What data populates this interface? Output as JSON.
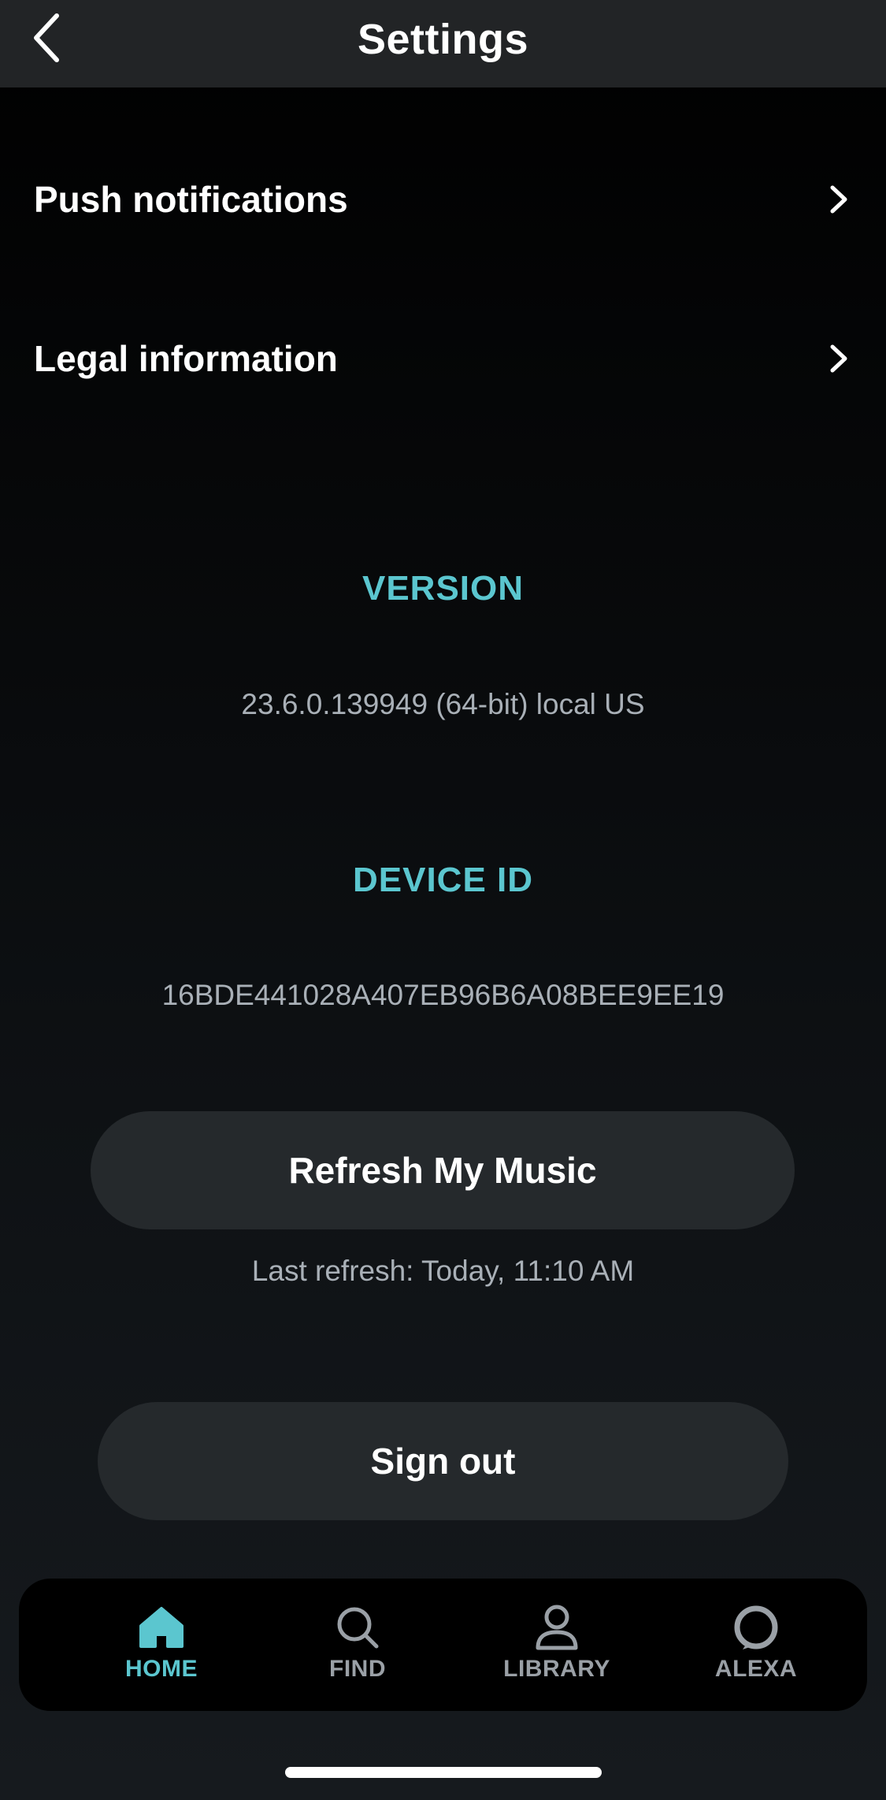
{
  "header": {
    "title": "Settings",
    "back_icon": "chevron-left-icon"
  },
  "menu": [
    {
      "label": "Push notifications",
      "icon": "chevron-right-icon"
    },
    {
      "label": "Legal information",
      "icon": "chevron-right-icon"
    }
  ],
  "version": {
    "title": "VERSION",
    "value": "23.6.0.139949 (64-bit) local US"
  },
  "device": {
    "title": "DEVICE ID",
    "value": "16BDE441028A407EB96B6A08BEE9EE19"
  },
  "refresh": {
    "label": "Refresh My Music",
    "caption": "Last refresh: Today, 11:10 AM"
  },
  "signout": {
    "label": "Sign out"
  },
  "tabs": [
    {
      "label": "HOME",
      "icon": "home-icon",
      "active": true
    },
    {
      "label": "FIND",
      "icon": "search-icon",
      "active": false
    },
    {
      "label": "LIBRARY",
      "icon": "person-icon",
      "active": false
    },
    {
      "label": "ALEXA",
      "icon": "alexa-ring-icon",
      "active": false
    }
  ],
  "colors": {
    "accent": "#5bc6cf",
    "header_bg": "#222426",
    "pill_bg": "#25292c",
    "muted_text": "#a9b0b7"
  }
}
